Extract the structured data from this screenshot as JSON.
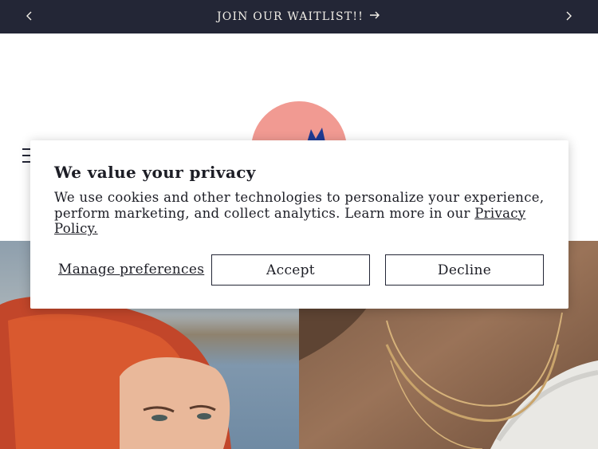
{
  "announcement": {
    "message": "JOIN OUR WAITLIST!!",
    "prev_icon": "chevron-left-icon",
    "next_icon": "chevron-right-icon",
    "arrow_icon": "arrow-right-icon"
  },
  "header": {
    "menu_icon": "hamburger-menu-icon",
    "logo": "cat-logo"
  },
  "cookie_banner": {
    "title": "We value your privacy",
    "body": "We use cookies and other technologies to personalize your experience, perform marketing, and collect analytics. Learn more in our",
    "privacy_link": "Privacy Policy.",
    "manage_label": "Manage preferences",
    "accept_label": "Accept",
    "decline_label": "Decline"
  },
  "colors": {
    "announcement_bg": "#232636",
    "logo_pink": "#f19a92",
    "logo_blue": "#1f3a93",
    "logo_gold": "#e3b33a"
  }
}
